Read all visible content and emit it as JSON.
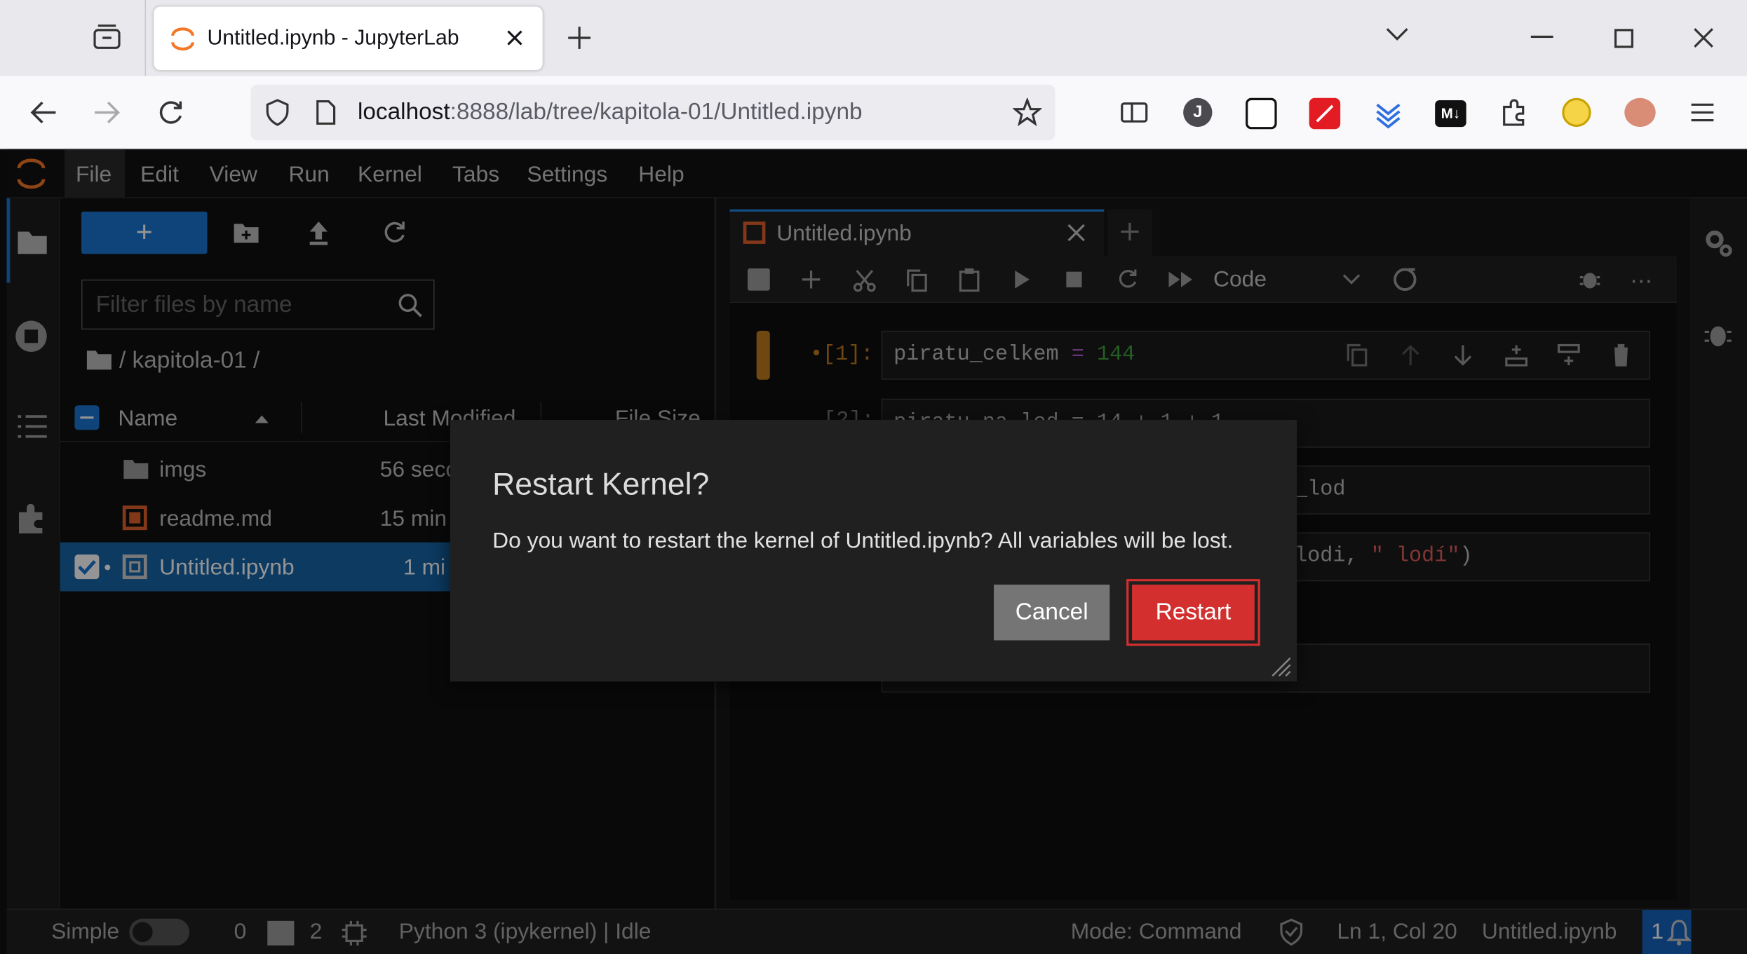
{
  "browser": {
    "tab_title": "Untitled.ipynb - JupyterLab",
    "url_host": "localhost",
    "url_rest": ":8888/lab/tree/kapitola-01/Untitled.ipynb",
    "extension_label_j": "J",
    "extension_label_md": "M↓"
  },
  "menu": [
    "File",
    "Edit",
    "View",
    "Run",
    "Kernel",
    "Tabs",
    "Settings",
    "Help"
  ],
  "filebrowser": {
    "new_label": "+",
    "filter_placeholder": "Filter files by name",
    "breadcrumb": "/ kapitola-01 /",
    "columns": {
      "name": "Name",
      "modified": "Last Modified",
      "size": "File Size"
    },
    "files": [
      {
        "name": "imgs",
        "modified": "56 seco",
        "type": "folder"
      },
      {
        "name": "readme.md",
        "modified": "15 min",
        "type": "markdown"
      },
      {
        "name": "Untitled.ipynb",
        "modified": "1 mi",
        "type": "notebook",
        "selected": true
      }
    ]
  },
  "notebook": {
    "tab_title": "Untitled.ipynb",
    "cell_type": "Code",
    "prompt_1": "•[1]:",
    "prompt_2": "[2]:",
    "cell_1_var": "piratu_celkem",
    "cell_1_op": " = ",
    "cell_1_num": "144",
    "cell_2_code": "piratu_na_lod = 14 + 1 + 1",
    "cell_3_tail": "_lod",
    "cell_4_tail_a": "lodi, ",
    "cell_4_tail_str": "\" lodí\"",
    "cell_4_tail_b": ")"
  },
  "dialog": {
    "title": "Restart Kernel?",
    "body": "Do you want to restart the kernel of Untitled.ipynb? All variables will be lost.",
    "cancel": "Cancel",
    "restart": "Restart"
  },
  "status": {
    "mode_label": "Simple",
    "terminals": "0",
    "kernels": "2",
    "kernel": "Python 3 (ipykernel) | Idle",
    "mode": "Mode: Command",
    "position": "Ln 1, Col 20",
    "file": "Untitled.ipynb",
    "notifications": "1"
  },
  "colors": {
    "accent": "#1976d2",
    "danger": "#d32f2f",
    "prompt": "#c27b1d",
    "number": "#3fa33f",
    "string": "#e05d5d",
    "operator": "#b05cd6"
  }
}
